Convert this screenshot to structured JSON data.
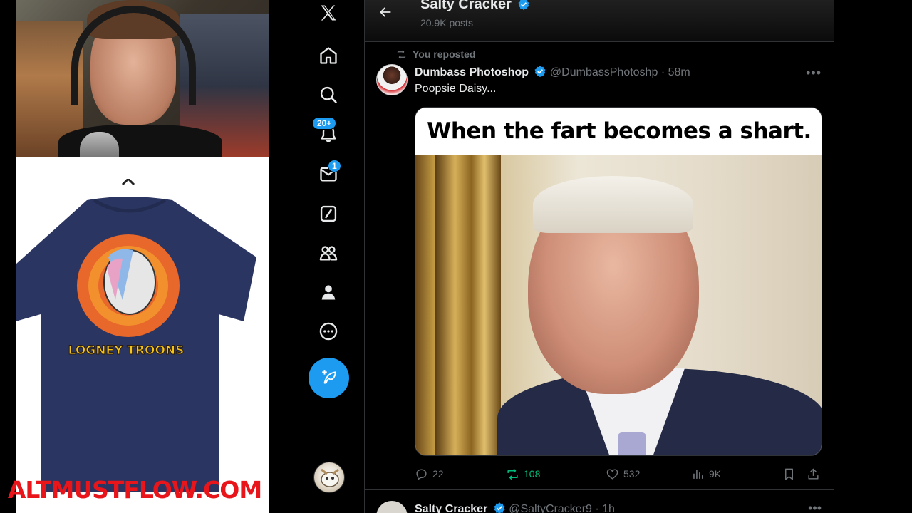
{
  "overlay": {
    "webcam_label": "streamer webcam",
    "shirt_print": "LOGNEY TROONS",
    "shop_url": "ALTMUSTFLOW.COM"
  },
  "nav": {
    "items": [
      {
        "name": "x-logo-icon"
      },
      {
        "name": "home-icon"
      },
      {
        "name": "search-icon"
      },
      {
        "name": "notifications-icon",
        "badge": "20+"
      },
      {
        "name": "messages-icon",
        "badge": "1"
      },
      {
        "name": "grok-icon"
      },
      {
        "name": "communities-icon"
      },
      {
        "name": "profile-icon"
      },
      {
        "name": "more-icon"
      }
    ],
    "accent": "#1d9bf0"
  },
  "header": {
    "name": "Salty Cracker",
    "posts": "20.9K posts"
  },
  "tweet": {
    "repost_label": "You reposted",
    "author": "Dumbass Photoshop",
    "handle": "@DumbassPhotoshp",
    "time": "· 58m",
    "text": "Poopsie Daisy...",
    "media_caption": "When the fart becomes a shart.",
    "replies": "22",
    "reposts": "108",
    "likes": "532",
    "views": "9K",
    "repost_color": "#00ba7c"
  },
  "next_tweet": {
    "author": "Salty Cracker",
    "handle": "@SaltyCracker9",
    "time": "· 1h"
  }
}
